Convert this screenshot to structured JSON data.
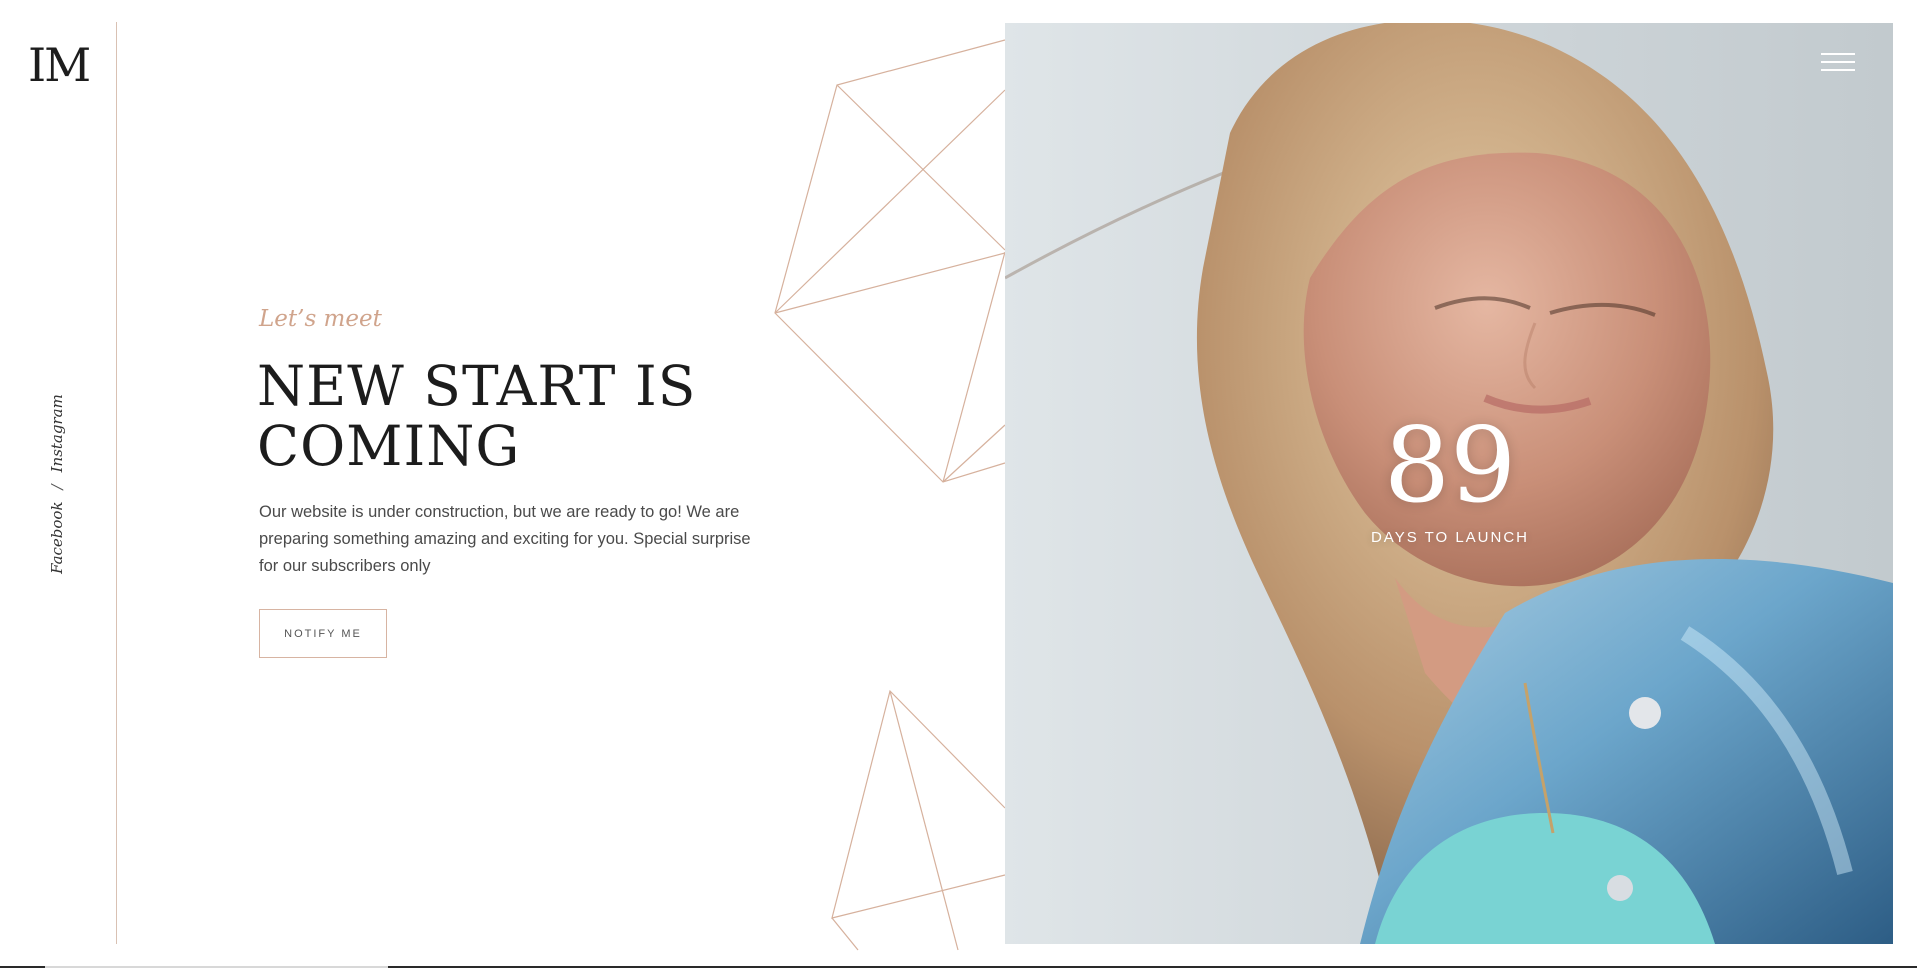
{
  "brand": {
    "logo": "IM"
  },
  "social": {
    "facebook": "Facebook",
    "separator": "/",
    "instagram": "Instagram"
  },
  "hero": {
    "eyebrow": "Let’s meet",
    "headline": [
      "NEW START IS",
      "COMING"
    ],
    "body": "Our website is under construction, but we are ready to go! We are preparing something amazing and exciting for you. Special surprise for our subscribers only",
    "button": "NOTIFY ME"
  },
  "countdown": {
    "value": "89",
    "label": "DAYS TO LAUNCH"
  },
  "colors": {
    "accent": "#d0a48c",
    "text": "#1c1c1c",
    "line": "#d9c1b3"
  },
  "icons": {
    "menu": "hamburger-icon"
  }
}
